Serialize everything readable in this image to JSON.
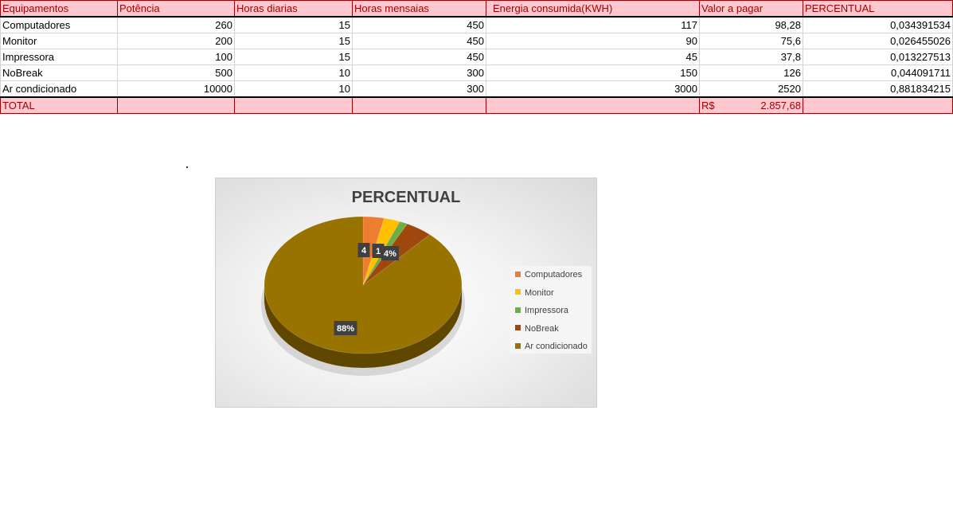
{
  "sheet": {
    "headers": [
      "Equipamentos",
      "Potência",
      "Horas diarias",
      "Horas mensaias",
      "Energia consumida(KWH)",
      "Valor a pagar",
      "PERCENTUAL"
    ],
    "rows": [
      [
        "Computadores",
        "260",
        "15",
        "450",
        "117",
        "98,28",
        "0,034391534"
      ],
      [
        "Monitor",
        "200",
        "15",
        "450",
        "90",
        "75,6",
        "0,026455026"
      ],
      [
        "Impressora",
        "100",
        "15",
        "450",
        "45",
        "37,8",
        "0,013227513"
      ],
      [
        "NoBreak",
        "500",
        "10",
        "300",
        "150",
        "126",
        "0,044091711"
      ],
      [
        "Ar condicionado",
        "10000",
        "10",
        "300",
        "3000",
        "2520",
        "0,881834215"
      ]
    ],
    "total": {
      "label": "TOTAL",
      "currency": "R$",
      "value": "2.857,68"
    }
  },
  "chart_data": {
    "type": "pie",
    "title": "PERCENTUAL",
    "categories": [
      "Computadores",
      "Monitor",
      "Impressora",
      "NoBreak",
      "Ar condicionado"
    ],
    "values": [
      0.034391534,
      0.026455026,
      0.013227513,
      0.044091711,
      0.881834215
    ],
    "data_labels": [
      "4",
      "1",
      "",
      "4%",
      "88%"
    ],
    "colors": [
      "#ed7d31",
      "#ffc000",
      "#70ad47",
      "#9e480e",
      "#997300"
    ],
    "legend_position": "right"
  }
}
